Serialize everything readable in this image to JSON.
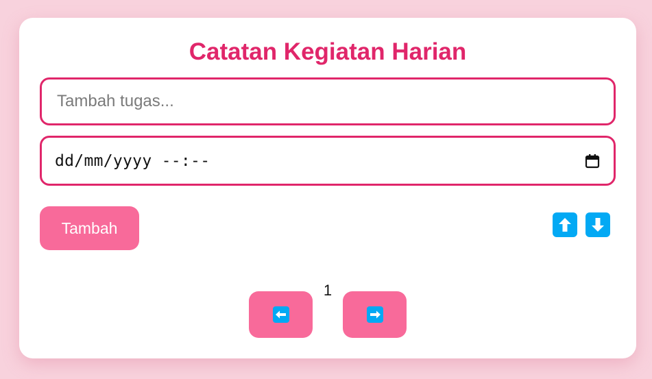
{
  "header": {
    "title": "Catatan Kegiatan Harian"
  },
  "form": {
    "task_placeholder": "Tambah tugas...",
    "task_value": "",
    "datetime_display": "dd/mm/yyyy --:--",
    "add_label": "Tambah"
  },
  "sort": {
    "up_icon": "arrow-up-icon",
    "down_icon": "arrow-down-icon"
  },
  "pagination": {
    "current_page": "1",
    "prev_icon": "arrow-left-icon",
    "next_icon": "arrow-right-icon"
  },
  "colors": {
    "background": "#f8d2dd",
    "accent": "#e0266a",
    "button": "#f86a9a",
    "icon_blue": "#03a9f4"
  }
}
